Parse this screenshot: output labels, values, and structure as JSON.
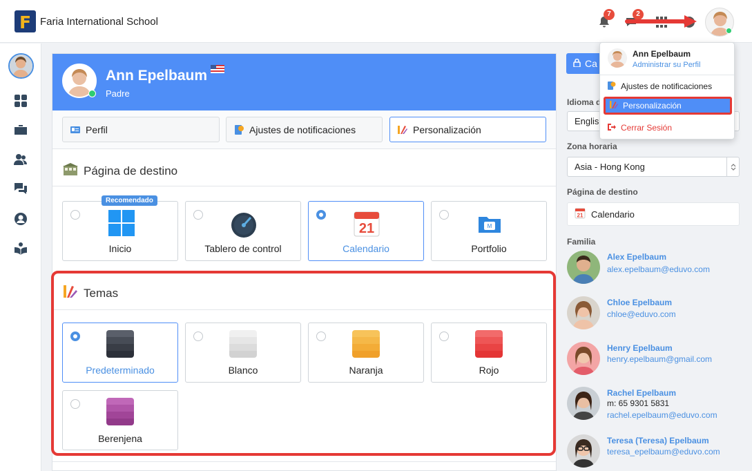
{
  "topbar": {
    "logo_letter": "F",
    "school_name": "Faria International School",
    "notifications_count": "7",
    "messages_count": "2"
  },
  "profile": {
    "name": "Ann Epelbaum",
    "role": "Padre"
  },
  "tabs": [
    {
      "label": "Perfil"
    },
    {
      "label": "Ajustes de notificaciones"
    },
    {
      "label": "Personalización"
    }
  ],
  "landing": {
    "title": "Página de destino",
    "recommended_badge": "Recomendado",
    "options": [
      {
        "label": "Inicio",
        "icon": "windows-grid-icon",
        "selected": false
      },
      {
        "label": "Tablero de control",
        "icon": "dashboard-gauge-icon",
        "selected": false
      },
      {
        "label": "Calendario",
        "icon": "calendar-icon",
        "selected": true
      },
      {
        "label": "Portfolio",
        "icon": "portfolio-folder-icon",
        "selected": false
      }
    ],
    "calendar_day": "21"
  },
  "themes": {
    "title": "Temas",
    "options": [
      {
        "label": "Predeterminado",
        "selected": true,
        "colors": [
          "#5a5f6a",
          "#474c56",
          "#393d46",
          "#2c3039"
        ]
      },
      {
        "label": "Blanco",
        "selected": false,
        "colors": [
          "#f0f0f0",
          "#e6e6e6",
          "#dcdcdc",
          "#d2d2d2"
        ]
      },
      {
        "label": "Naranja",
        "selected": false,
        "colors": [
          "#f7c35a",
          "#f5b848",
          "#f3ac37",
          "#f0a02a"
        ]
      },
      {
        "label": "Rojo",
        "selected": false,
        "colors": [
          "#f26b6b",
          "#ee5656",
          "#e94444",
          "#e43535"
        ]
      },
      {
        "label": "Berenjena",
        "selected": false,
        "colors": [
          "#c068b8",
          "#b055a8",
          "#a14598",
          "#923a8a"
        ]
      }
    ]
  },
  "right_panel": {
    "button_label": "Ca",
    "language_label": "Idioma d",
    "language_value": "Englis",
    "timezone_label": "Zona horaria",
    "timezone_value": "Asia - Hong Kong",
    "landing_label": "Página de destino",
    "landing_value": "Calendario",
    "landing_day": "21",
    "family_label": "Familia",
    "family": [
      {
        "name": "Alex Epelbaum",
        "phone": "",
        "email": "alex.epelbaum@eduvo.com"
      },
      {
        "name": "Chloe Epelbaum",
        "phone": "",
        "email": "chloe@eduvo.com"
      },
      {
        "name": "Henry Epelbaum",
        "phone": "",
        "email": "henry.epelbaum@gmail.com"
      },
      {
        "name": "Rachel Epelbaum",
        "phone": "m: 65 9301 5831",
        "email": "rachel.epelbaum@eduvo.com"
      },
      {
        "name": "Teresa (Teresa) Epelbaum",
        "phone": "",
        "email": "teresa_epelbaum@eduvo.com"
      }
    ]
  },
  "dropdown": {
    "name": "Ann Epelbaum",
    "manage_profile": "Administrar su Perfil",
    "items": [
      {
        "label": "Ajustes de notificaciones"
      },
      {
        "label": "Personalización"
      },
      {
        "label": "Cerrar Sesión"
      }
    ]
  },
  "colors": {
    "accent": "#4f8ef7",
    "annotation_red": "#e53935",
    "logo_bg": "#1d3c78",
    "logo_fg": "#f2b41b"
  }
}
